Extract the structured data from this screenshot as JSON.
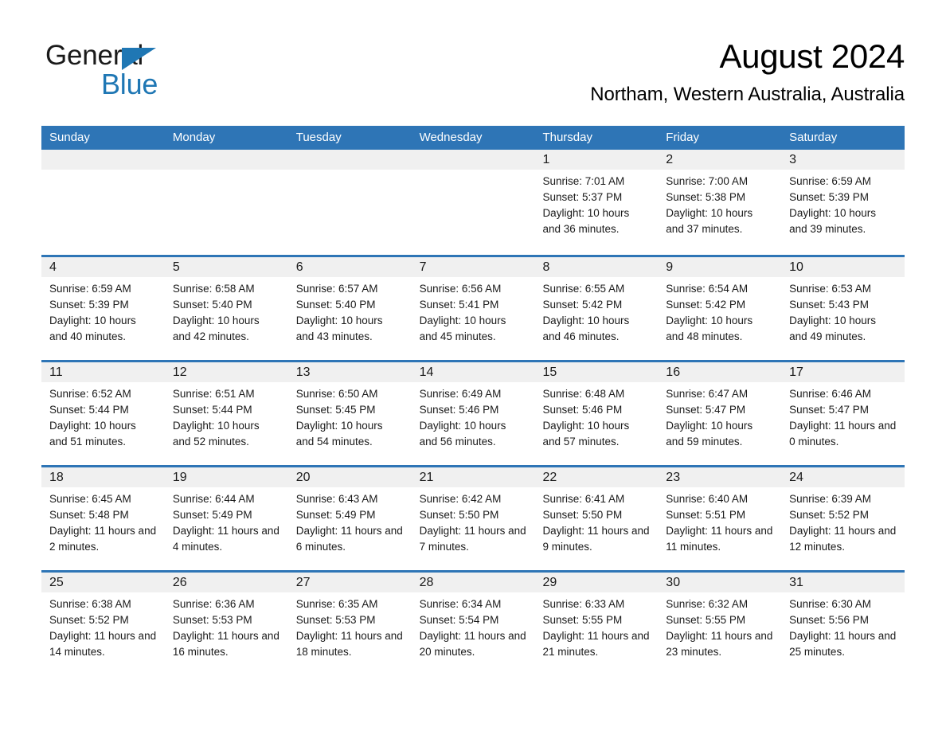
{
  "brand": {
    "name_part1": "General",
    "name_part2": "Blue",
    "triangle_color": "#1f77b4"
  },
  "header": {
    "month_title": "August 2024",
    "location": "Northam, Western Australia, Australia"
  },
  "theme": {
    "header_blue": "#2e75b6",
    "day_strip_gray": "#f0f0f0",
    "text_color": "#1a1a1a"
  },
  "calendar": {
    "weekdays": [
      "Sunday",
      "Monday",
      "Tuesday",
      "Wednesday",
      "Thursday",
      "Friday",
      "Saturday"
    ],
    "weeks": [
      [
        {
          "day": "",
          "empty": true
        },
        {
          "day": "",
          "empty": true
        },
        {
          "day": "",
          "empty": true
        },
        {
          "day": "",
          "empty": true
        },
        {
          "day": "1",
          "sunrise": "Sunrise: 7:01 AM",
          "sunset": "Sunset: 5:37 PM",
          "daylight": "Daylight: 10 hours and 36 minutes."
        },
        {
          "day": "2",
          "sunrise": "Sunrise: 7:00 AM",
          "sunset": "Sunset: 5:38 PM",
          "daylight": "Daylight: 10 hours and 37 minutes."
        },
        {
          "day": "3",
          "sunrise": "Sunrise: 6:59 AM",
          "sunset": "Sunset: 5:39 PM",
          "daylight": "Daylight: 10 hours and 39 minutes."
        }
      ],
      [
        {
          "day": "4",
          "sunrise": "Sunrise: 6:59 AM",
          "sunset": "Sunset: 5:39 PM",
          "daylight": "Daylight: 10 hours and 40 minutes."
        },
        {
          "day": "5",
          "sunrise": "Sunrise: 6:58 AM",
          "sunset": "Sunset: 5:40 PM",
          "daylight": "Daylight: 10 hours and 42 minutes."
        },
        {
          "day": "6",
          "sunrise": "Sunrise: 6:57 AM",
          "sunset": "Sunset: 5:40 PM",
          "daylight": "Daylight: 10 hours and 43 minutes."
        },
        {
          "day": "7",
          "sunrise": "Sunrise: 6:56 AM",
          "sunset": "Sunset: 5:41 PM",
          "daylight": "Daylight: 10 hours and 45 minutes."
        },
        {
          "day": "8",
          "sunrise": "Sunrise: 6:55 AM",
          "sunset": "Sunset: 5:42 PM",
          "daylight": "Daylight: 10 hours and 46 minutes."
        },
        {
          "day": "9",
          "sunrise": "Sunrise: 6:54 AM",
          "sunset": "Sunset: 5:42 PM",
          "daylight": "Daylight: 10 hours and 48 minutes."
        },
        {
          "day": "10",
          "sunrise": "Sunrise: 6:53 AM",
          "sunset": "Sunset: 5:43 PM",
          "daylight": "Daylight: 10 hours and 49 minutes."
        }
      ],
      [
        {
          "day": "11",
          "sunrise": "Sunrise: 6:52 AM",
          "sunset": "Sunset: 5:44 PM",
          "daylight": "Daylight: 10 hours and 51 minutes."
        },
        {
          "day": "12",
          "sunrise": "Sunrise: 6:51 AM",
          "sunset": "Sunset: 5:44 PM",
          "daylight": "Daylight: 10 hours and 52 minutes."
        },
        {
          "day": "13",
          "sunrise": "Sunrise: 6:50 AM",
          "sunset": "Sunset: 5:45 PM",
          "daylight": "Daylight: 10 hours and 54 minutes."
        },
        {
          "day": "14",
          "sunrise": "Sunrise: 6:49 AM",
          "sunset": "Sunset: 5:46 PM",
          "daylight": "Daylight: 10 hours and 56 minutes."
        },
        {
          "day": "15",
          "sunrise": "Sunrise: 6:48 AM",
          "sunset": "Sunset: 5:46 PM",
          "daylight": "Daylight: 10 hours and 57 minutes."
        },
        {
          "day": "16",
          "sunrise": "Sunrise: 6:47 AM",
          "sunset": "Sunset: 5:47 PM",
          "daylight": "Daylight: 10 hours and 59 minutes."
        },
        {
          "day": "17",
          "sunrise": "Sunrise: 6:46 AM",
          "sunset": "Sunset: 5:47 PM",
          "daylight": "Daylight: 11 hours and 0 minutes."
        }
      ],
      [
        {
          "day": "18",
          "sunrise": "Sunrise: 6:45 AM",
          "sunset": "Sunset: 5:48 PM",
          "daylight": "Daylight: 11 hours and 2 minutes."
        },
        {
          "day": "19",
          "sunrise": "Sunrise: 6:44 AM",
          "sunset": "Sunset: 5:49 PM",
          "daylight": "Daylight: 11 hours and 4 minutes."
        },
        {
          "day": "20",
          "sunrise": "Sunrise: 6:43 AM",
          "sunset": "Sunset: 5:49 PM",
          "daylight": "Daylight: 11 hours and 6 minutes."
        },
        {
          "day": "21",
          "sunrise": "Sunrise: 6:42 AM",
          "sunset": "Sunset: 5:50 PM",
          "daylight": "Daylight: 11 hours and 7 minutes."
        },
        {
          "day": "22",
          "sunrise": "Sunrise: 6:41 AM",
          "sunset": "Sunset: 5:50 PM",
          "daylight": "Daylight: 11 hours and 9 minutes."
        },
        {
          "day": "23",
          "sunrise": "Sunrise: 6:40 AM",
          "sunset": "Sunset: 5:51 PM",
          "daylight": "Daylight: 11 hours and 11 minutes."
        },
        {
          "day": "24",
          "sunrise": "Sunrise: 6:39 AM",
          "sunset": "Sunset: 5:52 PM",
          "daylight": "Daylight: 11 hours and 12 minutes."
        }
      ],
      [
        {
          "day": "25",
          "sunrise": "Sunrise: 6:38 AM",
          "sunset": "Sunset: 5:52 PM",
          "daylight": "Daylight: 11 hours and 14 minutes."
        },
        {
          "day": "26",
          "sunrise": "Sunrise: 6:36 AM",
          "sunset": "Sunset: 5:53 PM",
          "daylight": "Daylight: 11 hours and 16 minutes."
        },
        {
          "day": "27",
          "sunrise": "Sunrise: 6:35 AM",
          "sunset": "Sunset: 5:53 PM",
          "daylight": "Daylight: 11 hours and 18 minutes."
        },
        {
          "day": "28",
          "sunrise": "Sunrise: 6:34 AM",
          "sunset": "Sunset: 5:54 PM",
          "daylight": "Daylight: 11 hours and 20 minutes."
        },
        {
          "day": "29",
          "sunrise": "Sunrise: 6:33 AM",
          "sunset": "Sunset: 5:55 PM",
          "daylight": "Daylight: 11 hours and 21 minutes."
        },
        {
          "day": "30",
          "sunrise": "Sunrise: 6:32 AM",
          "sunset": "Sunset: 5:55 PM",
          "daylight": "Daylight: 11 hours and 23 minutes."
        },
        {
          "day": "31",
          "sunrise": "Sunrise: 6:30 AM",
          "sunset": "Sunset: 5:56 PM",
          "daylight": "Daylight: 11 hours and 25 minutes."
        }
      ]
    ]
  }
}
